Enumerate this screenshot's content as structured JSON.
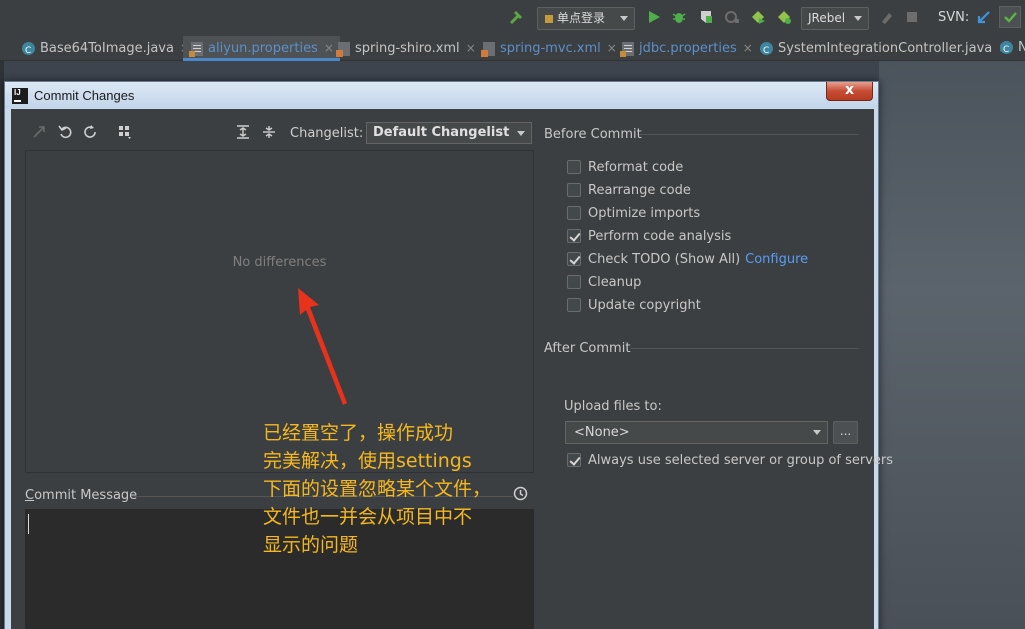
{
  "toolbar": {
    "run_config": "单点登录",
    "jrebel": "JRebel",
    "svn_label": "SVN:"
  },
  "tabs": [
    {
      "label": "Base64ToImage.java",
      "icon": "class-icon",
      "close": "×"
    },
    {
      "label": "aliyun.properties",
      "icon": "properties-icon",
      "close": "×",
      "active": true
    },
    {
      "label": "spring-shiro.xml",
      "icon": "xml-icon",
      "close": "×"
    },
    {
      "label": "spring-mvc.xml",
      "icon": "xml-icon",
      "close": "×"
    },
    {
      "label": "jdbc.properties",
      "icon": "properties-icon",
      "close": "×"
    },
    {
      "label": "SystemIntegrationController.java",
      "icon": "class-icon",
      "close": "×"
    },
    {
      "label": "N",
      "icon": "class-icon"
    }
  ],
  "dialog": {
    "title": "Commit Changes",
    "close_glyph": "x",
    "changelist_label": "Changelist:",
    "changelist_value": "Default Changelist",
    "no_differences": "No differences",
    "commit_message_label": "Commit Message",
    "before_commit": {
      "title": "Before Commit",
      "options": [
        {
          "label": "Reformat code",
          "checked": false
        },
        {
          "label": "Rearrange code",
          "checked": false
        },
        {
          "label": "Optimize imports",
          "checked": false
        },
        {
          "label": "Perform code analysis",
          "checked": true
        },
        {
          "label": "Check TODO (Show All)",
          "checked": true,
          "link": "Configure"
        },
        {
          "label": "Cleanup",
          "checked": false
        },
        {
          "label": "Update copyright",
          "checked": false
        }
      ]
    },
    "after_commit": {
      "title": "After Commit",
      "upload_label": "Upload files to:",
      "upload_value": "<None>",
      "browse_label": "...",
      "always_use": {
        "label": "Always use selected server or group of servers",
        "checked": true
      }
    }
  },
  "annotation": {
    "lines": [
      "已经置空了，操作成功",
      "完美解决，使用settings",
      "下面的设置忽略某个文件，",
      "文件也一并会从项目中不",
      "显示的问题"
    ],
    "color": "#f5b81e",
    "arrow_color": "#e8321c"
  }
}
